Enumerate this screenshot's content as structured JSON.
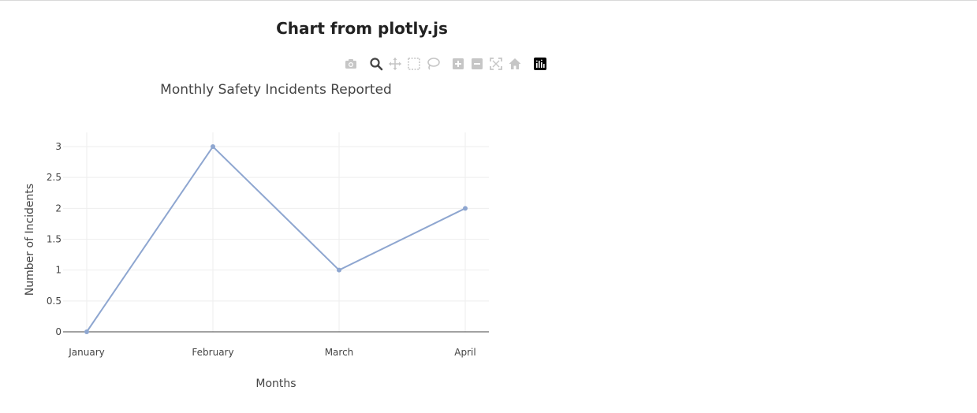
{
  "page": {
    "heading": "Chart from plotly.js"
  },
  "modebar": {
    "buttons": [
      {
        "name": "camera-icon",
        "active": false
      },
      {
        "name": "zoom-icon",
        "active": true
      },
      {
        "name": "pan-icon",
        "active": false
      },
      {
        "name": "box-select-icon",
        "active": false
      },
      {
        "name": "lasso-select-icon",
        "active": false
      },
      {
        "name": "zoom-in-icon",
        "active": false
      },
      {
        "name": "zoom-out-icon",
        "active": false
      },
      {
        "name": "autoscale-icon",
        "active": false
      },
      {
        "name": "reset-axes-icon",
        "active": false
      },
      {
        "name": "plotly-logo-icon",
        "active": false
      }
    ]
  },
  "chart_data": {
    "type": "line",
    "title": "Monthly Safety Incidents Reported",
    "xlabel": "Months",
    "ylabel": "Number of Incidents",
    "categories": [
      "January",
      "February",
      "March",
      "April"
    ],
    "series": [
      {
        "values": [
          0,
          3,
          1,
          2
        ],
        "color": "#8ea6d0",
        "mode": "lines+markers"
      }
    ],
    "ylim": [
      0,
      3
    ],
    "yticks": [
      "0",
      "0.5",
      "1",
      "1.5",
      "2",
      "2.5",
      "3"
    ],
    "grid": true,
    "legend": "none"
  }
}
